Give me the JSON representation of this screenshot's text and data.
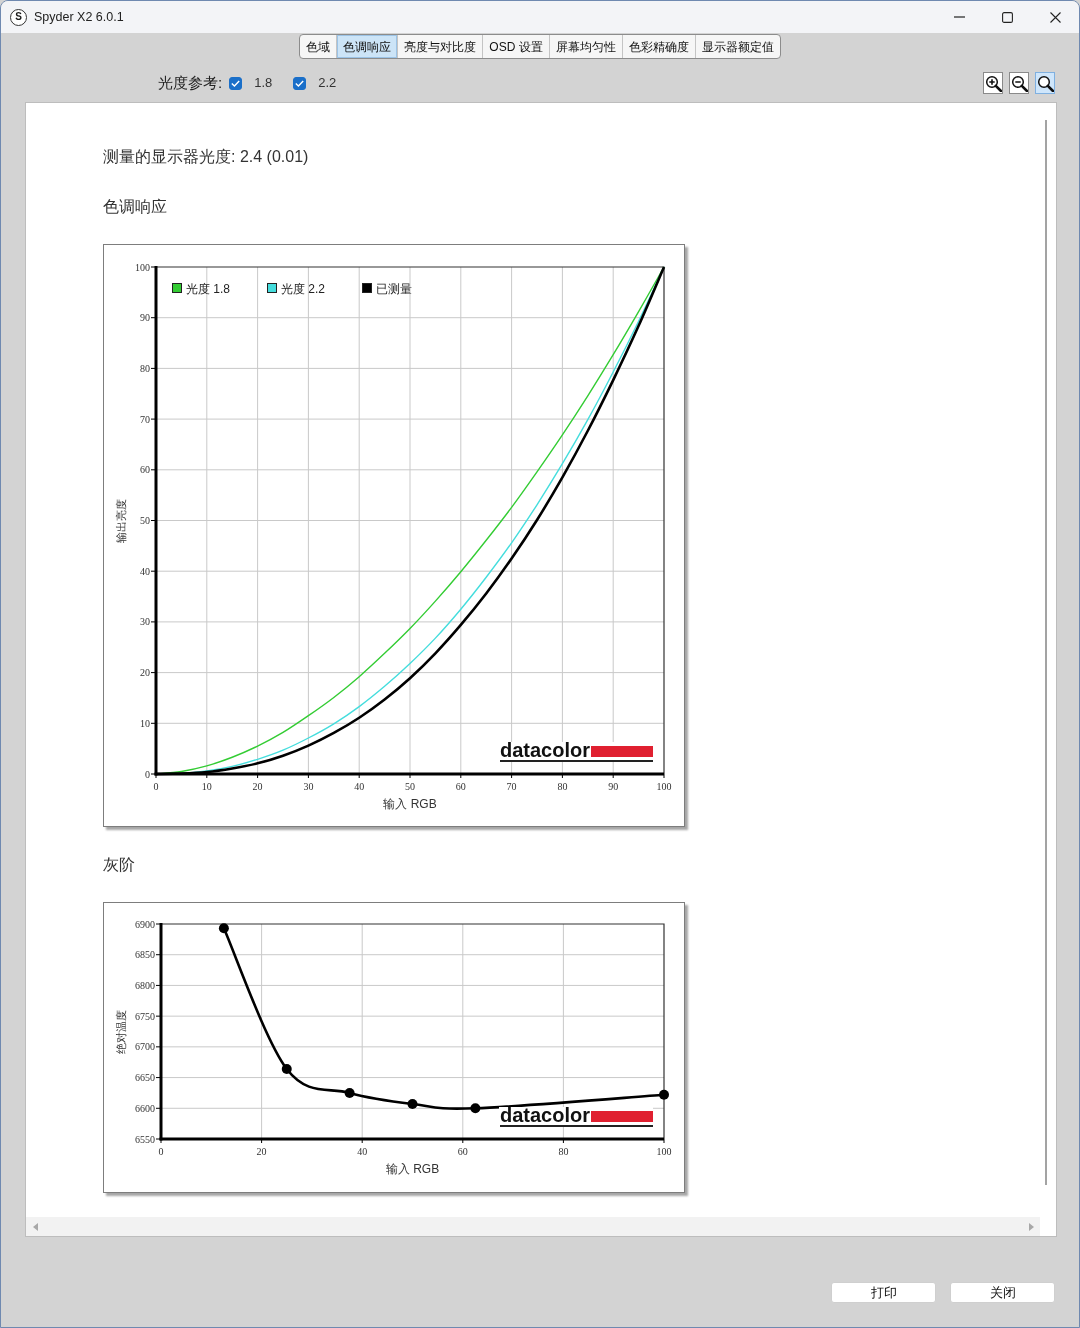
{
  "window": {
    "icon_letter": "S",
    "title": "Spyder X2 6.0.1"
  },
  "tabs": [
    {
      "label": "色域",
      "selected": false
    },
    {
      "label": "色调响应",
      "selected": true
    },
    {
      "label": "亮度与对比度",
      "selected": false
    },
    {
      "label": "OSD 设置",
      "selected": false
    },
    {
      "label": "屏幕均匀性",
      "selected": false
    },
    {
      "label": "色彩精确度",
      "selected": false
    },
    {
      "label": "显示器额定值",
      "selected": false
    }
  ],
  "gamma_reference": {
    "label": "光度参考:",
    "options": [
      {
        "label": "1.8",
        "checked": true
      },
      {
        "label": "2.2",
        "checked": true
      }
    ]
  },
  "zoom_tools": [
    {
      "kind": "zoom_in",
      "selected": false
    },
    {
      "kind": "zoom_out",
      "selected": false
    },
    {
      "kind": "zoom_fit",
      "selected": true
    }
  ],
  "report": {
    "measured_gamma": "测量的显示器光度: 2.4 (0.01)",
    "sections": [
      {
        "title": "色调响应",
        "kind": "tone_curve",
        "logo": "datacolor",
        "chart_data": {
          "type": "line",
          "xlabel": "输入 RGB",
          "ylabel": "输出亮度",
          "x": [
            0,
            5,
            10,
            15,
            20,
            25,
            30,
            35,
            40,
            45,
            50,
            55,
            60,
            65,
            70,
            75,
            80,
            85,
            90,
            95,
            100
          ],
          "series": [
            {
              "name": "光度 1.8",
              "color": "#33cc33",
              "values": [
                0,
                0.5,
                1.6,
                3.3,
                5.5,
                8.2,
                11.5,
                15.1,
                19.2,
                23.8,
                28.7,
                34.1,
                39.9,
                46.1,
                52.6,
                59.6,
                66.9,
                74.6,
                82.7,
                91.2,
                100
              ]
            },
            {
              "name": "光度 2.2",
              "color": "#44dddd",
              "values": [
                0,
                0.1,
                0.6,
                1.5,
                2.9,
                4.7,
                7.1,
                9.9,
                13.3,
                17.3,
                21.8,
                26.8,
                32.5,
                38.8,
                45.6,
                53.1,
                61.2,
                69.9,
                79.3,
                89.3,
                100
              ]
            },
            {
              "name": "已测量",
              "color": "#000000",
              "values": [
                0,
                0.1,
                0.4,
                1.1,
                2.1,
                3.6,
                5.6,
                8.1,
                11.1,
                14.7,
                18.9,
                23.8,
                29.4,
                35.6,
                42.5,
                50.1,
                58.5,
                67.7,
                77.7,
                88.4,
                100
              ]
            }
          ],
          "xlim": [
            0,
            100
          ],
          "ylim": [
            0,
            100
          ],
          "xticks": [
            0,
            10,
            20,
            30,
            40,
            50,
            60,
            70,
            80,
            90,
            100
          ],
          "yticks": [
            0,
            10,
            20,
            30,
            40,
            50,
            60,
            70,
            80,
            90,
            100
          ],
          "grid": true,
          "legend": "upper left"
        }
      },
      {
        "title": "灰阶",
        "kind": "color_temperature",
        "logo": "datacolor",
        "chart_data": {
          "type": "line",
          "xlabel": "输入 RGB",
          "ylabel": "绝对温度",
          "x": [
            12.5,
            25,
            37.5,
            50,
            62.5,
            100
          ],
          "values": [
            6893,
            6664,
            6625,
            6607,
            6600,
            6622
          ],
          "xlim": [
            0,
            100
          ],
          "ylim": [
            6550,
            6900
          ],
          "xticks": [
            0,
            20,
            40,
            60,
            80,
            100
          ],
          "yticks": [
            6550,
            6600,
            6650,
            6700,
            6750,
            6800,
            6850,
            6900
          ],
          "grid": true,
          "marker": "circle"
        }
      }
    ]
  },
  "buttons": [
    {
      "label": "打印"
    },
    {
      "label": "关闭"
    }
  ]
}
